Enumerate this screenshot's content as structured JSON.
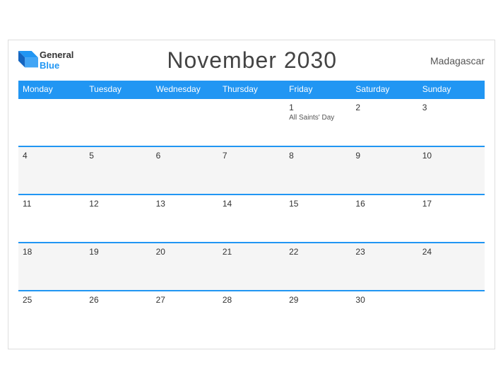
{
  "header": {
    "logo": {
      "general": "General",
      "blue": "Blue"
    },
    "title": "November 2030",
    "country": "Madagascar"
  },
  "weekdays": [
    "Monday",
    "Tuesday",
    "Wednesday",
    "Thursday",
    "Friday",
    "Saturday",
    "Sunday"
  ],
  "weeks": [
    [
      {
        "day": "",
        "holiday": ""
      },
      {
        "day": "",
        "holiday": ""
      },
      {
        "day": "",
        "holiday": ""
      },
      {
        "day": "",
        "holiday": ""
      },
      {
        "day": "1",
        "holiday": "All Saints' Day"
      },
      {
        "day": "2",
        "holiday": ""
      },
      {
        "day": "3",
        "holiday": ""
      }
    ],
    [
      {
        "day": "4",
        "holiday": ""
      },
      {
        "day": "5",
        "holiday": ""
      },
      {
        "day": "6",
        "holiday": ""
      },
      {
        "day": "7",
        "holiday": ""
      },
      {
        "day": "8",
        "holiday": ""
      },
      {
        "day": "9",
        "holiday": ""
      },
      {
        "day": "10",
        "holiday": ""
      }
    ],
    [
      {
        "day": "11",
        "holiday": ""
      },
      {
        "day": "12",
        "holiday": ""
      },
      {
        "day": "13",
        "holiday": ""
      },
      {
        "day": "14",
        "holiday": ""
      },
      {
        "day": "15",
        "holiday": ""
      },
      {
        "day": "16",
        "holiday": ""
      },
      {
        "day": "17",
        "holiday": ""
      }
    ],
    [
      {
        "day": "18",
        "holiday": ""
      },
      {
        "day": "19",
        "holiday": ""
      },
      {
        "day": "20",
        "holiday": ""
      },
      {
        "day": "21",
        "holiday": ""
      },
      {
        "day": "22",
        "holiday": ""
      },
      {
        "day": "23",
        "holiday": ""
      },
      {
        "day": "24",
        "holiday": ""
      }
    ],
    [
      {
        "day": "25",
        "holiday": ""
      },
      {
        "day": "26",
        "holiday": ""
      },
      {
        "day": "27",
        "holiday": ""
      },
      {
        "day": "28",
        "holiday": ""
      },
      {
        "day": "29",
        "holiday": ""
      },
      {
        "day": "30",
        "holiday": ""
      },
      {
        "day": "",
        "holiday": ""
      }
    ]
  ]
}
